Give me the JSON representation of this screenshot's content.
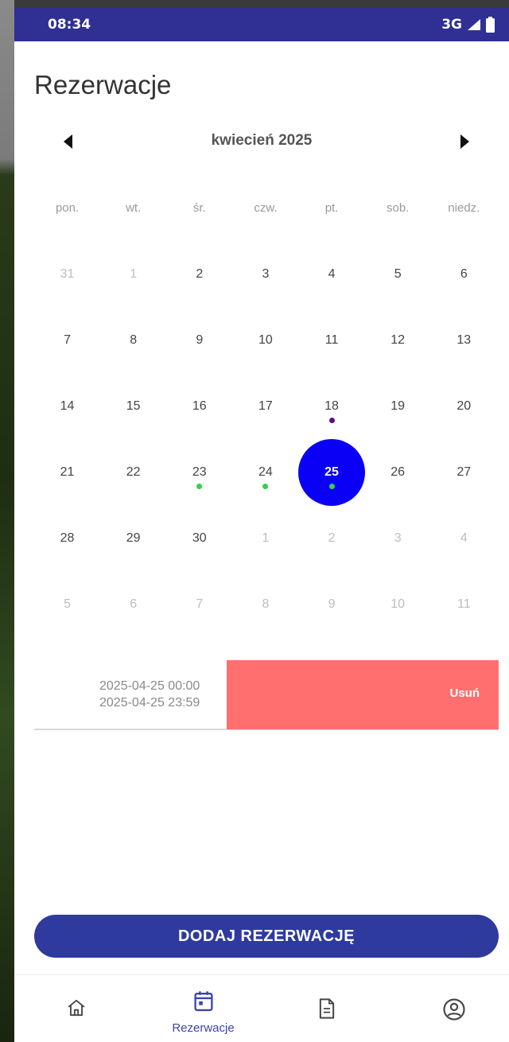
{
  "status_bar": {
    "time": "08:34",
    "network": "3G"
  },
  "page": {
    "title": "Rezerwacje"
  },
  "calendar": {
    "month_label": "kwiecień 2025",
    "weekdays": [
      "pon.",
      "wt.",
      "śr.",
      "czw.",
      "pt.",
      "sob.",
      "niedz."
    ],
    "weeks": [
      [
        {
          "d": "31",
          "muted": true
        },
        {
          "d": "1",
          "muted": true
        },
        {
          "d": "2"
        },
        {
          "d": "3"
        },
        {
          "d": "4"
        },
        {
          "d": "5"
        },
        {
          "d": "6"
        }
      ],
      [
        {
          "d": "7"
        },
        {
          "d": "8"
        },
        {
          "d": "9"
        },
        {
          "d": "10"
        },
        {
          "d": "11"
        },
        {
          "d": "12"
        },
        {
          "d": "13"
        }
      ],
      [
        {
          "d": "14"
        },
        {
          "d": "15"
        },
        {
          "d": "16"
        },
        {
          "d": "17"
        },
        {
          "d": "18",
          "dot": "purple"
        },
        {
          "d": "19"
        },
        {
          "d": "20"
        }
      ],
      [
        {
          "d": "21"
        },
        {
          "d": "22"
        },
        {
          "d": "23",
          "dot": "green"
        },
        {
          "d": "24",
          "dot": "green"
        },
        {
          "d": "25",
          "selected": true,
          "dot": "green"
        },
        {
          "d": "26"
        },
        {
          "d": "27"
        }
      ],
      [
        {
          "d": "28"
        },
        {
          "d": "29"
        },
        {
          "d": "30"
        },
        {
          "d": "1",
          "muted": true
        },
        {
          "d": "2",
          "muted": true
        },
        {
          "d": "3",
          "muted": true
        },
        {
          "d": "4",
          "muted": true
        }
      ],
      [
        {
          "d": "5",
          "muted": true
        },
        {
          "d": "6",
          "muted": true
        },
        {
          "d": "7",
          "muted": true
        },
        {
          "d": "8",
          "muted": true
        },
        {
          "d": "9",
          "muted": true
        },
        {
          "d": "10",
          "muted": true
        },
        {
          "d": "11",
          "muted": true
        }
      ]
    ],
    "colors": {
      "selected": "#0a00f5",
      "dot_green": "#33d24a",
      "dot_purple": "#5a0f8a"
    }
  },
  "reservation": {
    "start": "2025-04-25 00:00",
    "end": "2025-04-25 23:59",
    "delete_label": "Usuń"
  },
  "add_button": {
    "label": "DODAJ REZERWACJĘ"
  },
  "bottom_nav": {
    "items": [
      {
        "icon": "home-icon",
        "label": ""
      },
      {
        "icon": "calendar-icon",
        "label": "Rezerwacje",
        "active": true
      },
      {
        "icon": "document-icon",
        "label": ""
      },
      {
        "icon": "profile-icon",
        "label": ""
      }
    ]
  }
}
